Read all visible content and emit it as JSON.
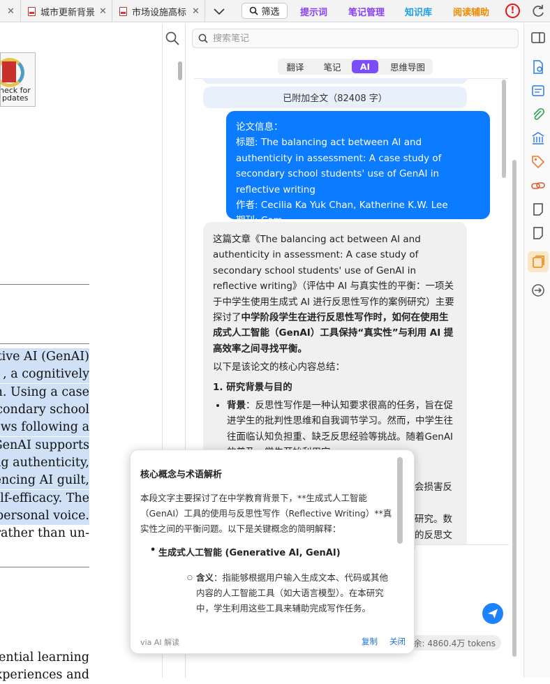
{
  "tabs": [
    {
      "label": "",
      "closable": true
    },
    {
      "label": "城市更新背景",
      "closable": true
    },
    {
      "label": "市场设施高标",
      "closable": true
    }
  ],
  "toolbar": {
    "filter_label": "筛选",
    "prompt_label": "提示词",
    "notes_label": "笔记管理",
    "kb_label": "知识库",
    "reading_label": "阅读辅助",
    "colors": {
      "prompt": "#8a3ffc",
      "notes": "#8a3ffc",
      "kb": "#1aa0e8",
      "reading": "#f08a00",
      "alert": "#e11111"
    }
  },
  "note_search": {
    "placeholder": "搜索笔记"
  },
  "mode_tabs": [
    {
      "label": "翻译",
      "active": false
    },
    {
      "label": "笔记",
      "active": false
    },
    {
      "label": "AI",
      "active": true
    },
    {
      "label": "思维导图",
      "active": false
    }
  ],
  "pdf": {
    "crossmark_text": [
      "heck for",
      "pdates"
    ],
    "lines": [
      {
        "text": "tive AI (GenAI)",
        "highlight": true
      },
      {
        "text": ", a cognitively",
        "highlight": true
      },
      {
        "text": "on. Using a case",
        "highlight": true
      },
      {
        "text": "econdary school",
        "highlight": true
      },
      {
        "text": "ws following a",
        "highlight": true
      },
      {
        "text": "GenAI supports",
        "highlight": true
      },
      {
        "text": "ng authenticity,",
        "highlight": true
      },
      {
        "text": "encing AI guilt,",
        "highlight": true
      },
      {
        "text": "elf-efficacy. The",
        "highlight": true
      },
      {
        "text": "personal voice.",
        "highlight": true
      },
      {
        "text": "rather than un-",
        "highlight": false
      },
      {
        "text": "ential learning",
        "highlight": false
      },
      {
        "text": "xperiences and",
        "highlight": false
      }
    ]
  },
  "chat": {
    "attached_text": "已附加全文（82408 字）",
    "user_message": [
      "论文信息：",
      "标题: The balancing act between AI and authenticity in assessment: A case study of secondary school students' use of GenAI in reflective writing",
      "作者: Cecilia Ka Yuk Chan, Katherine K.W. Lee",
      "期刊: Com..."
    ],
    "ai_intro_normal": "这篇文章《The balancing act between AI and authenticity in assessment: A case study of secondary school students' use of GenAI in reflective writing》（评估中 AI 与真实性的平衡：一项关于中学生使用生成式 AI 进行反思性写作的案例研究）主要探讨了",
    "ai_intro_bold": "中学阶段学生在进行反思性写作时，如何在使用生成式人工智能（GenAI）工具保持“真实性”与利用 AI 提高效率之间寻找平衡。",
    "ai_summary_lead": "以下是该论文的核心内容总结：",
    "ai_section1": "1. 研究背景与目的",
    "ai_bullet_label": "背景",
    "ai_bullet_text": "：反思性写作是一种认知要求很高的任务，旨在促进学生的批判性思维和自我调节学习。然而，中学生往往面临认知负担重、缺乏反思经验等挑战。随着GenAI的普及，学生开始利用它",
    "ai_hidden_tail_1": "会损害反",
    "ai_hidden_tail_2": "研究。数",
    "ai_hidden_tail_3": "的反思文",
    "tokens": "剩余: 4860.4万 tokens"
  },
  "popup": {
    "title": "核心概念与术语解析",
    "body": "本段文字主要探讨了在中学教育背景下，**生成式人工智能（GenAI）工具的使用与反思性写作（Reflective Writing）**真实性之间的平衡问题。以下是关键概念的简明解释：",
    "bullet": "生成式人工智能 (Generative AI, GenAI)",
    "sub_label": "含义",
    "sub_text": "：指能够根据用户输入生成文本、代码或其他内容的人工智能工具（如大语言模型）。在本研究中，学生利用这些工具来辅助完成写作任务。",
    "footer": "via AI 解读",
    "copy": "复制",
    "close": "关闭"
  }
}
